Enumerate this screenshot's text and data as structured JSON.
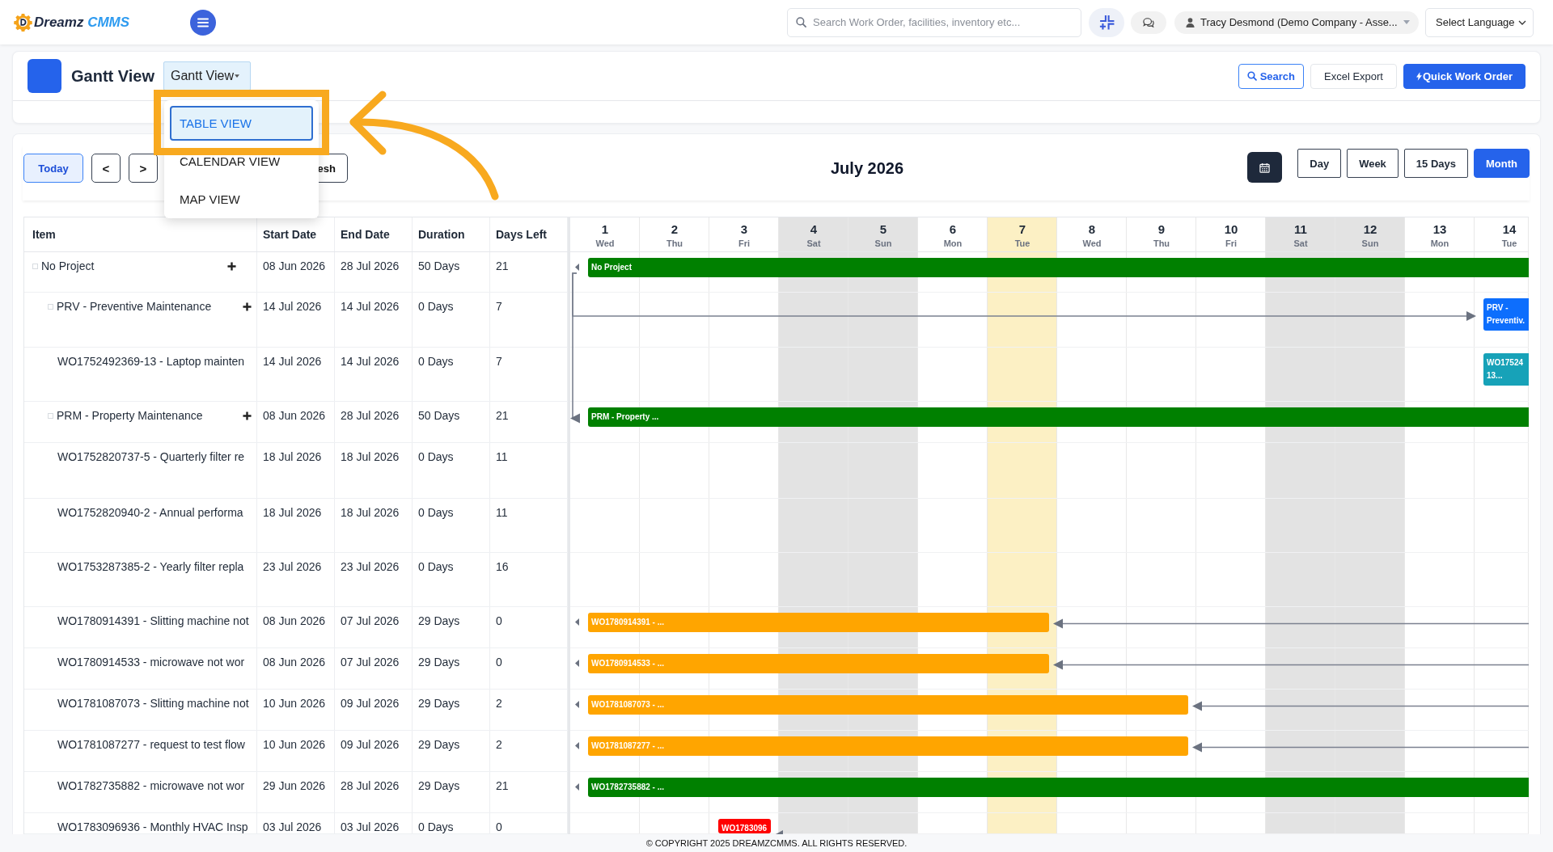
{
  "header": {
    "logo": {
      "word_1": "Dreamz",
      "word_2": "CMMS"
    },
    "search": {
      "placeholder": "Search Work Order, facilities, inventory etc..."
    },
    "user": {
      "name": "Tracy Desmond (Demo Company - Asse..."
    },
    "language_select": {
      "value": "Select Language"
    }
  },
  "page_header": {
    "title": "Gantt View",
    "view_dropdown": {
      "label": "Gantt View",
      "expanded": true,
      "options": [
        {
          "label": "TABLE VIEW",
          "selected": true,
          "annotated": true
        },
        {
          "label": "CALENDAR VIEW",
          "selected": false,
          "annotated": false
        },
        {
          "label": "MAP VIEW",
          "selected": false,
          "annotated": false
        }
      ]
    },
    "buttons": [
      {
        "label": "Search",
        "kind": "search"
      },
      {
        "label": "Excel Export",
        "kind": "export"
      },
      {
        "label": "Quick Work Order",
        "kind": "create"
      }
    ]
  },
  "toolbar": {
    "nav_buttons": [
      {
        "label": "Today",
        "kind": "today"
      },
      {
        "label": "<",
        "kind": "prev"
      },
      {
        "label": ">",
        "kind": "next"
      },
      {
        "label": "esh",
        "kind": "refresh"
      }
    ],
    "period_title": "July 2026",
    "range_tabs": [
      {
        "label": "Day",
        "selected": false
      },
      {
        "label": "Week",
        "selected": false
      },
      {
        "label": "15 Days",
        "selected": false
      },
      {
        "label": "Month",
        "selected": true
      }
    ]
  },
  "gantt": {
    "columns": [
      "Item",
      "Start Date",
      "End Date",
      "Duration",
      "Days Left"
    ],
    "days": [
      {
        "day": "1",
        "weekday": "Wed",
        "weekend": false,
        "today": false
      },
      {
        "day": "2",
        "weekday": "Thu",
        "weekend": false,
        "today": false
      },
      {
        "day": "3",
        "weekday": "Fri",
        "weekend": false,
        "today": false
      },
      {
        "day": "4",
        "weekday": "Sat",
        "weekend": true,
        "today": false
      },
      {
        "day": "5",
        "weekday": "Sun",
        "weekend": true,
        "today": false
      },
      {
        "day": "6",
        "weekday": "Mon",
        "weekend": false,
        "today": false
      },
      {
        "day": "7",
        "weekday": "Tue",
        "weekend": false,
        "today": true
      },
      {
        "day": "8",
        "weekday": "Wed",
        "weekend": false,
        "today": false
      },
      {
        "day": "9",
        "weekday": "Thu",
        "weekend": false,
        "today": false
      },
      {
        "day": "10",
        "weekday": "Fri",
        "weekend": false,
        "today": false
      },
      {
        "day": "11",
        "weekday": "Sat",
        "weekend": true,
        "today": false
      },
      {
        "day": "12",
        "weekday": "Sun",
        "weekend": true,
        "today": false
      },
      {
        "day": "13",
        "weekday": "Mon",
        "weekend": false,
        "today": false
      },
      {
        "day": "14",
        "weekday": "Tue",
        "weekend": false,
        "today": false
      }
    ],
    "rows": [
      {
        "name": "No Project",
        "kind": "group",
        "checked": false,
        "start_date": "08 Jun 2026",
        "end_date": "28 Jul 2026",
        "duration": "50 Days",
        "days_left": "21",
        "bar": {
          "label": "No Project",
          "color": "#008000"
        },
        "children": [
          {
            "name": "PRV - Preventive Maintenance",
            "kind": "group",
            "checked": false,
            "start_date": "14 Jul 2026",
            "end_date": "14 Jul 2026",
            "duration": "0 Days",
            "days_left": "7",
            "bar": {
              "label": "PRV - Preventiv.",
              "color": "#0d6efd",
              "dependency": {
                "kind": "from_parent"
              }
            },
            "children": [
              {
                "name": "WO1752492369-13 - Laptop mainten",
                "kind": "task",
                "start_date": "14 Jul 2026",
                "end_date": "14 Jul 2026",
                "duration": "0 Days",
                "days_left": "7",
                "bar": {
                  "label": "WO17524 13...",
                  "color": "#17a2b8"
                }
              }
            ]
          },
          {
            "name": "PRM - Property Maintenance",
            "kind": "group",
            "checked": false,
            "start_date": "08 Jun 2026",
            "end_date": "28 Jul 2026",
            "duration": "50 Days",
            "days_left": "21",
            "bar": {
              "label": "PRM - Property ...",
              "color": "#008000",
              "dependency": {
                "kind": "from_parent"
              }
            },
            "children": [
              {
                "name": "WO1752820737-5 - Quarterly filter re",
                "kind": "task",
                "start_date": "18 Jul 2026",
                "end_date": "18 Jul 2026",
                "duration": "0 Days",
                "days_left": "11"
              },
              {
                "name": "WO1752820940-2 - Annual performa",
                "kind": "task",
                "start_date": "18 Jul 2026",
                "end_date": "18 Jul 2026",
                "duration": "0 Days",
                "days_left": "11"
              },
              {
                "name": "WO1753287385-2 - Yearly filter repla",
                "kind": "task",
                "start_date": "23 Jul 2026",
                "end_date": "23 Jul 2026",
                "duration": "0 Days",
                "days_left": "16"
              },
              {
                "name": "WO1780914391 - Slitting machine not",
                "kind": "task",
                "start_date": "08 Jun 2026",
                "end_date": "07 Jul 2026",
                "duration": "29 Days",
                "days_left": "0",
                "bar": {
                  "label": "WO1780914391 - ...",
                  "color": "#ffa500",
                  "dependency": {
                    "kind": "from_right"
                  }
                }
              },
              {
                "name": "WO1780914533 - microwave not wor",
                "kind": "task",
                "start_date": "08 Jun 2026",
                "end_date": "07 Jul 2026",
                "duration": "29 Days",
                "days_left": "0",
                "bar": {
                  "label": "WO1780914533 - ...",
                  "color": "#ffa500",
                  "dependency": {
                    "kind": "from_right"
                  }
                }
              },
              {
                "name": "WO1781087073 - Slitting machine not",
                "kind": "task",
                "start_date": "10 Jun 2026",
                "end_date": "09 Jul 2026",
                "duration": "29 Days",
                "days_left": "2",
                "bar": {
                  "label": "WO1781087073 - ...",
                  "color": "#ffa500",
                  "dependency": {
                    "kind": "from_right"
                  }
                }
              },
              {
                "name": "WO1781087277 - request to test flow",
                "kind": "task",
                "start_date": "10 Jun 2026",
                "end_date": "09 Jul 2026",
                "duration": "29 Days",
                "days_left": "2",
                "bar": {
                  "label": "WO1781087277 - ...",
                  "color": "#ffa500",
                  "dependency": {
                    "kind": "from_right"
                  }
                }
              },
              {
                "name": "WO1782735882 - microwave not wor",
                "kind": "task",
                "start_date": "29 Jun 2026",
                "end_date": "28 Jul 2026",
                "duration": "29 Days",
                "days_left": "21",
                "bar": {
                  "label": "WO1782735882 - ...",
                  "color": "#008000"
                }
              },
              {
                "name": "WO1783096936 - Monthly HVAC Insp",
                "kind": "task",
                "start_date": "03 Jul 2026",
                "end_date": "03 Jul 2026",
                "duration": "0 Days",
                "days_left": "0",
                "bar": {
                  "label": "WO1783096",
                  "color": "#ff0000",
                  "dependency": {
                    "kind": "stub"
                  }
                }
              }
            ]
          }
        ]
      }
    ]
  },
  "footer": {
    "copyright": "© COPYRIGHT 2025 DREAMZCMMS. ALL RIGHTS RESERVED."
  }
}
